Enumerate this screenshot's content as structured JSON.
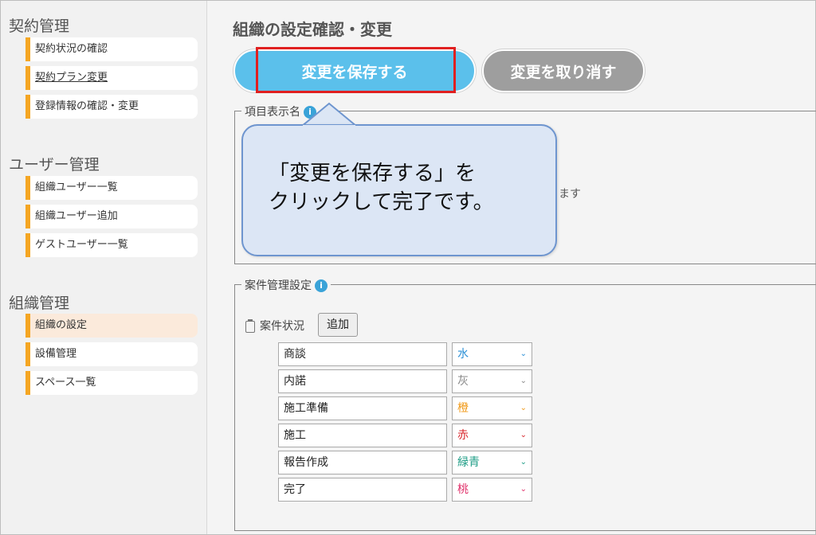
{
  "sidebar": {
    "sections": [
      {
        "title": "契約管理",
        "items": [
          "契約状況の確認",
          "契約プラン変更",
          "登録情報の確認・変更"
        ]
      },
      {
        "title": "ユーザー管理",
        "items": [
          "組織ユーザー一覧",
          "組織ユーザー追加",
          "ゲストユーザー一覧"
        ]
      },
      {
        "title": "組織管理",
        "items": [
          "組織の設定",
          "設備管理",
          "スペース一覧"
        ]
      }
    ]
  },
  "main": {
    "title": "組織の設定確認・変更",
    "save_label": "変更を保存する",
    "cancel_label": "変更を取り消す",
    "field_display_legend": "項目表示名",
    "partial_text": "ます",
    "case_legend": "案件管理設定",
    "info_icon": "i",
    "status_label": "案件状況",
    "add_label": "追加",
    "tooltip": "「変更を保存する」を\nクリックして完了です。",
    "statuses": [
      {
        "name": "商談",
        "color": "水",
        "color_hex": "#2a8fd6"
      },
      {
        "name": "内諾",
        "color": "灰",
        "color_hex": "#888888"
      },
      {
        "name": "施工準備",
        "color": "橙",
        "color_hex": "#f09a1a"
      },
      {
        "name": "施工",
        "color": "赤",
        "color_hex": "#d8262b"
      },
      {
        "name": "報告作成",
        "color": "緑青",
        "color_hex": "#1e9d86"
      },
      {
        "name": "完了",
        "color": "桃",
        "color_hex": "#e0306a"
      }
    ]
  }
}
